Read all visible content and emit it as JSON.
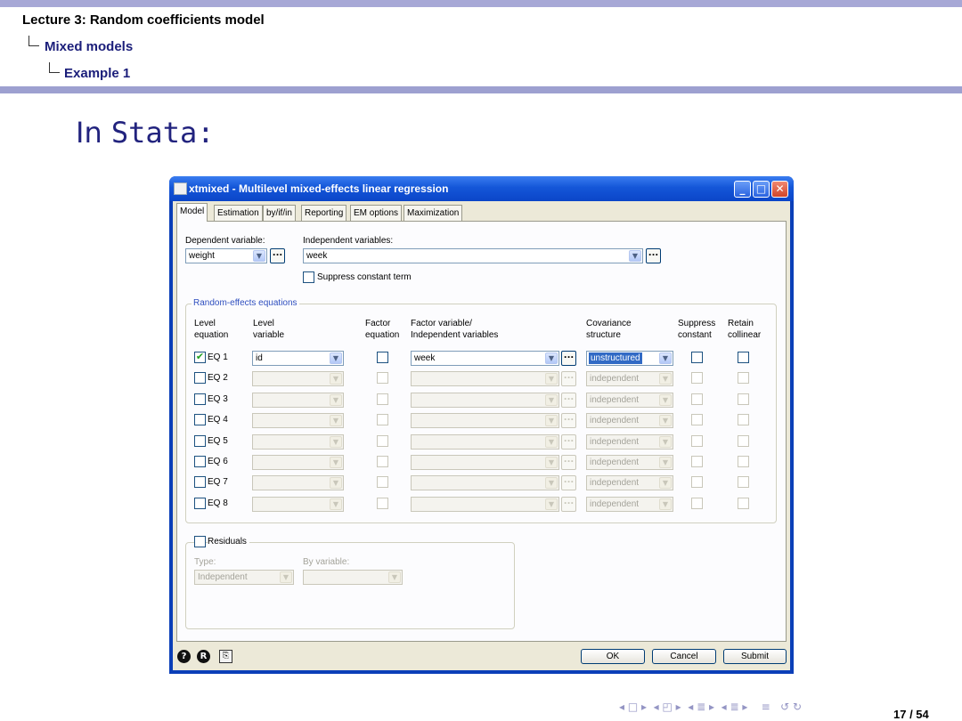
{
  "header": {
    "line1": "Lecture 3: Random coefficients model",
    "line2": "Mixed models",
    "line3": "Example 1"
  },
  "slide": {
    "title_prefix": "In ",
    "title_mono": "Stata:"
  },
  "window": {
    "title": "xtmixed - Multilevel mixed-effects linear regression",
    "tabs": [
      "Model",
      "Estimation",
      "by/if/in",
      "Reporting",
      "EM options",
      "Maximization"
    ],
    "dependent_label": "Dependent variable:",
    "dependent_value": "weight",
    "independent_label": "Independent variables:",
    "independent_value": "week",
    "suppress_constant": "Suppress constant term",
    "re_group_label": "Random-effects equations",
    "columns": {
      "level_equation": [
        "Level",
        "equation"
      ],
      "level_variable": [
        "Level",
        "variable"
      ],
      "factor_equation": [
        "Factor",
        "equation"
      ],
      "factor_variable": [
        "Factor variable/",
        "Independent variables"
      ],
      "covariance": [
        "Covariance",
        "structure"
      ],
      "suppress": [
        "Suppress",
        "constant"
      ],
      "retain": [
        "Retain",
        "collinear"
      ]
    },
    "equations": [
      {
        "label": "EQ 1",
        "checked": true,
        "level_variable": "id",
        "factor_variable": "week",
        "covariance": "unstructured"
      },
      {
        "label": "EQ 2",
        "checked": false,
        "level_variable": "",
        "factor_variable": "",
        "covariance": "independent"
      },
      {
        "label": "EQ 3",
        "checked": false,
        "level_variable": "",
        "factor_variable": "",
        "covariance": "independent"
      },
      {
        "label": "EQ 4",
        "checked": false,
        "level_variable": "",
        "factor_variable": "",
        "covariance": "independent"
      },
      {
        "label": "EQ 5",
        "checked": false,
        "level_variable": "",
        "factor_variable": "",
        "covariance": "independent"
      },
      {
        "label": "EQ 6",
        "checked": false,
        "level_variable": "",
        "factor_variable": "",
        "covariance": "independent"
      },
      {
        "label": "EQ 7",
        "checked": false,
        "level_variable": "",
        "factor_variable": "",
        "covariance": "independent"
      },
      {
        "label": "EQ 8",
        "checked": false,
        "level_variable": "",
        "factor_variable": "",
        "covariance": "independent"
      }
    ],
    "residuals": {
      "label": "Residuals",
      "type_label": "Type:",
      "type_value": "Independent",
      "by_label": "By variable:"
    },
    "buttons": {
      "ok": "OK",
      "cancel": "Cancel",
      "submit": "Submit"
    }
  },
  "footer": {
    "page": "17 / 54"
  },
  "colors": {
    "beamer_bar": "#a7a8d6",
    "title_blue": "#22237e",
    "xp_title": "#0b45c8"
  }
}
